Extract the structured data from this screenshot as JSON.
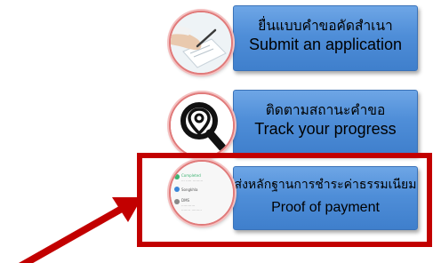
{
  "menu": {
    "submit": {
      "thai": "ยื่นแบบคำขอคัดสำเนา",
      "english": "Submit an application",
      "icon": "hand-writing-document-icon"
    },
    "track": {
      "thai": "ติดตามสถานะคำขอ",
      "english": "Track your progress",
      "icon": "location-magnifier-icon"
    },
    "payment": {
      "thai": "ส่งหลักฐานการชำระค่าธรรมเนียม",
      "english": "Proof of payment",
      "icon": "payment-slip-screenshot-icon"
    }
  },
  "mini_app": {
    "rows": [
      "Completed",
      "Songkhla",
      "DMS"
    ]
  },
  "colors": {
    "button_blue": "#4f8ed8",
    "highlight_red": "#c20000",
    "circle_border": "#e07a7a"
  }
}
